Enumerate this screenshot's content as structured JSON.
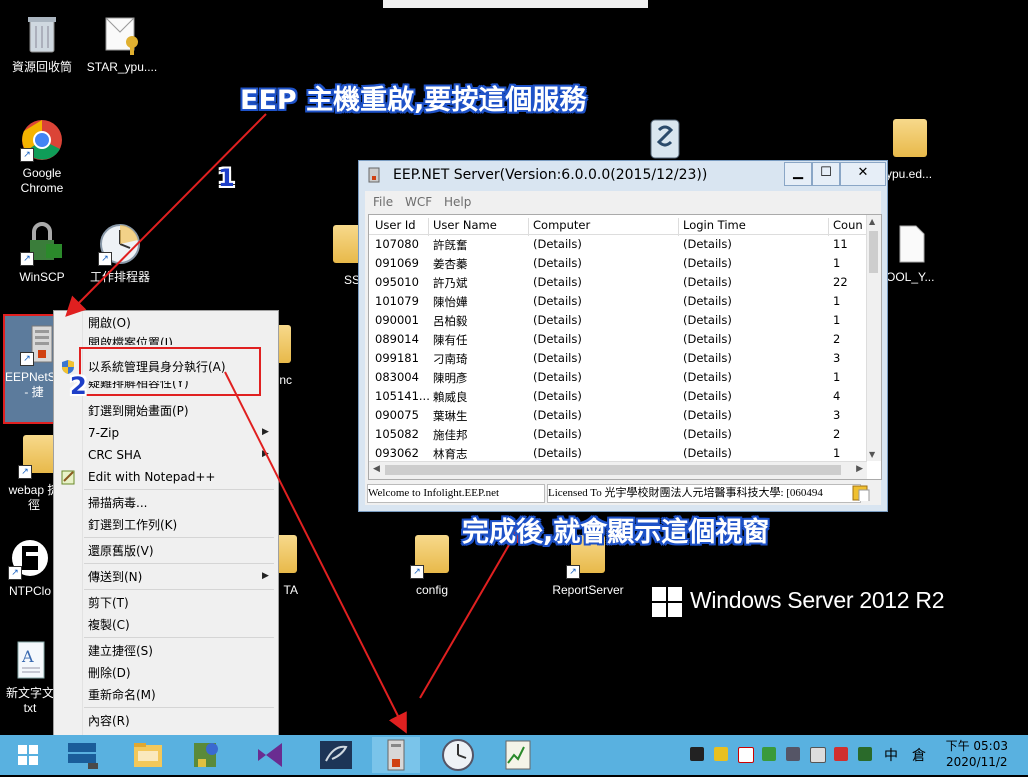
{
  "desktop_icons": [
    {
      "label": "資源回收筒"
    },
    {
      "label": "STAR_ypu...."
    },
    {
      "label": "Google Chrome"
    },
    {
      "label": "WinSCP"
    },
    {
      "label": "工作排程器"
    },
    {
      "label": "EEPNetS r - 捷"
    },
    {
      "label": "webap 捷徑"
    },
    {
      "label": "NTPClo"
    },
    {
      "label": "新文字文 txt"
    },
    {
      "label": "config"
    },
    {
      "label": "ReportServer"
    },
    {
      "label": "ypu.ed..."
    },
    {
      "label": "OOL_Y..."
    },
    {
      "label": "SS"
    },
    {
      "label": "TA"
    },
    {
      "label": "nc"
    }
  ],
  "annotations": {
    "top_callout": "EEP 主機重啟,要按這個服務",
    "bottom_callout": "完成後,就會顯示這個視窗",
    "step1": "1",
    "step2": "2"
  },
  "branding": {
    "windows_server": "Windows Server 2012 R2"
  },
  "context_menu": {
    "items": [
      {
        "label": "開啟(O)"
      },
      {
        "label": "開啟檔案位置(I)"
      },
      {
        "label": "以系統管理員身分執行(A)"
      },
      {
        "label": "疑難排解相容性(Y)"
      },
      {
        "label": "釘選到開始畫面(P)"
      },
      {
        "label": "7-Zip"
      },
      {
        "label": "CRC SHA"
      },
      {
        "label": "Edit with Notepad++"
      },
      {
        "label": "掃描病毒..."
      },
      {
        "label": "釘選到工作列(K)"
      },
      {
        "label": "還原舊版(V)"
      },
      {
        "label": "傳送到(N)"
      },
      {
        "label": "剪下(T)"
      },
      {
        "label": "複製(C)"
      },
      {
        "label": "建立捷徑(S)"
      },
      {
        "label": "刪除(D)"
      },
      {
        "label": "重新命名(M)"
      },
      {
        "label": "內容(R)"
      }
    ]
  },
  "window": {
    "title": "EEP.NET Server(Version:6.0.0.0(2015/12/23))",
    "menu": [
      "File",
      "WCF",
      "Help"
    ],
    "columns": [
      "User Id",
      "User Name",
      "Computer",
      "Login Time",
      "Coun"
    ],
    "rows": [
      [
        "107080",
        "許旣奮",
        "(Details)",
        "(Details)",
        "11"
      ],
      [
        "091069",
        "姜杏蓁",
        "(Details)",
        "(Details)",
        "1"
      ],
      [
        "095010",
        "許乃斌",
        "(Details)",
        "(Details)",
        "22"
      ],
      [
        "101079",
        "陳怡嬅",
        "(Details)",
        "(Details)",
        "1"
      ],
      [
        "090001",
        "呂柏毅",
        "(Details)",
        "(Details)",
        "1"
      ],
      [
        "089014",
        "陳有任",
        "(Details)",
        "(Details)",
        "2"
      ],
      [
        "099181",
        "刁南琦",
        "(Details)",
        "(Details)",
        "3"
      ],
      [
        "083004",
        "陳明彥",
        "(Details)",
        "(Details)",
        "1"
      ],
      [
        "105141...",
        "賴威良",
        "(Details)",
        "(Details)",
        "4"
      ],
      [
        "090075",
        "葉琳生",
        "(Details)",
        "(Details)",
        "3"
      ],
      [
        "105082",
        "施佳邦",
        "(Details)",
        "(Details)",
        "2"
      ],
      [
        "093062",
        "林育志",
        "(Details)",
        "(Details)",
        "1"
      ]
    ],
    "status_left": "Welcome to Infolight.EEP.net",
    "status_right": "Licensed To 光宇學校財團法人元培醫事科技大學: [060494"
  },
  "taskbar": {
    "clock_time": "下午 05:03",
    "clock_date": "2020/11/2",
    "ime1": "中",
    "ime2": "倉"
  }
}
